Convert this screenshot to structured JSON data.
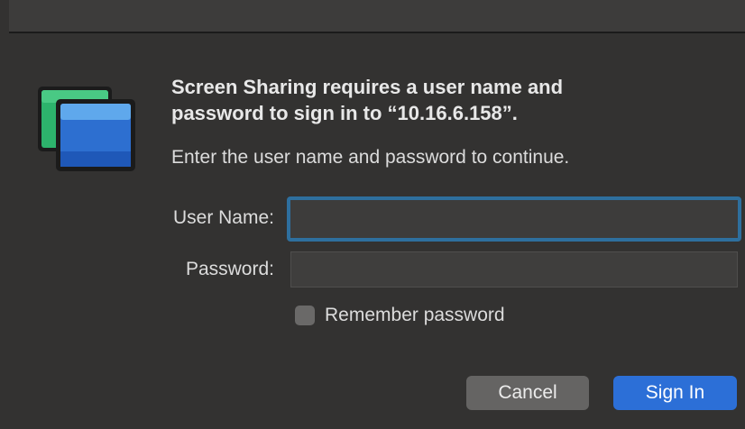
{
  "dialog": {
    "headline": "Screen Sharing requires a user name and\npassword to sign in to “10.16.6.158”.",
    "subtext": "Enter the user name and password to continue."
  },
  "form": {
    "user_name_label": "User Name:",
    "user_name_value": "",
    "password_label": "Password:",
    "password_value": "",
    "remember_label": "Remember password",
    "remember_checked": false
  },
  "buttons": {
    "cancel_label": "Cancel",
    "signin_label": "Sign In"
  },
  "icon": {
    "app_icon": "screen-sharing-icon"
  },
  "colors": {
    "accent": "#2c6fd7",
    "focus_ring": "#2e6f9e",
    "background": "#333231"
  }
}
